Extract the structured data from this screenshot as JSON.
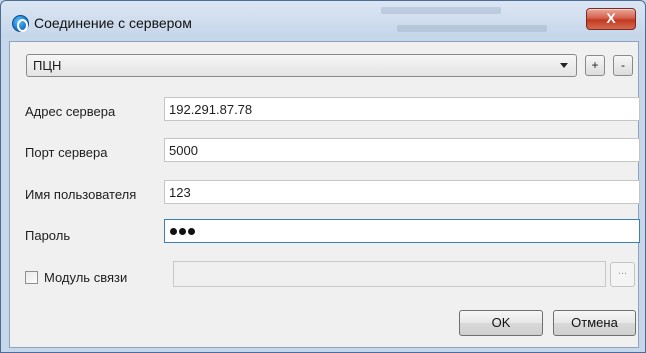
{
  "window": {
    "title": "Соединение с сервером",
    "close_label": "X"
  },
  "profile": {
    "selected": "ПЦН",
    "add_label": "+",
    "remove_label": "-"
  },
  "form": {
    "server_address": {
      "label": "Адрес сервера",
      "value": "192.291.87.78"
    },
    "server_port": {
      "label": "Порт сервера",
      "value": "5000"
    },
    "username": {
      "label": "Имя пользователя",
      "value": "123"
    },
    "password": {
      "label": "Пароль",
      "masked_length": 3
    },
    "comm_module": {
      "label": "Модуль связи",
      "checked": false,
      "value": "",
      "browse_label": "..."
    }
  },
  "buttons": {
    "ok_label": "OK",
    "cancel_label": "Отмена"
  },
  "colors": {
    "close_button": "#c23a22",
    "titlebar": "#c7d7ea",
    "focus_border": "#3c7fb1"
  }
}
